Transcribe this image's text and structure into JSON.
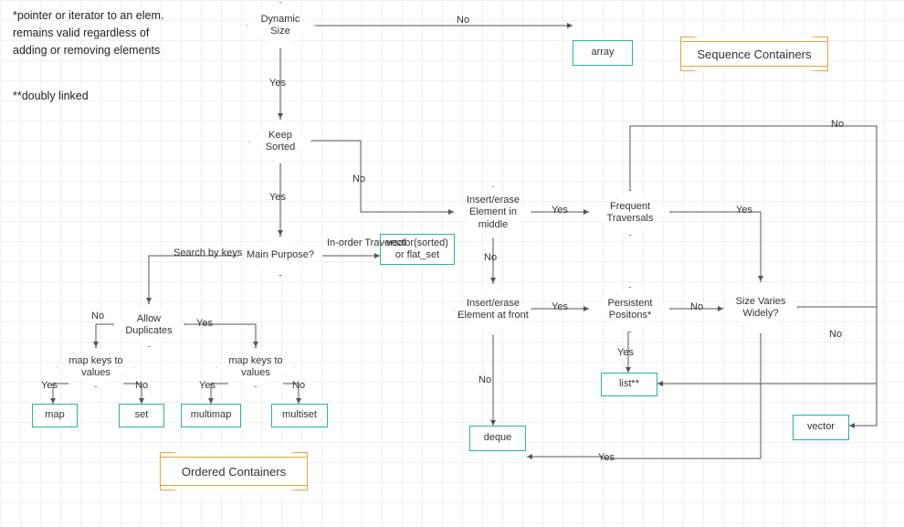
{
  "notes": {
    "note1": "*pointer or iterator to an elem. remains valid regardless of adding or removing elements",
    "note2": "**doubly linked"
  },
  "banners": {
    "sequence": "Sequence Containers",
    "ordered": "Ordered Containers"
  },
  "nodes": {
    "dynamic_size": "Dynamic Size",
    "keep_sorted": "Keep Sorted",
    "main_purpose": "Main Purpose?",
    "allow_duplicates": "Allow Duplicates",
    "map_keys_left": "map keys to values",
    "map_keys_right": "map keys to values",
    "insert_middle": "Insert/erase Element in middle",
    "insert_front": "Insert/erase Element at front",
    "frequent_traversals": "Frequent Traversals",
    "persistent_positions": "Persistent Positons*",
    "size_varies": "Size Varies Widely?",
    "array": "array",
    "vector_sorted": "vector(sorted) or flat_set",
    "map": "map",
    "set": "set",
    "multimap": "multimap",
    "multiset": "multiset",
    "list": "list**",
    "deque": "deque",
    "vector": "vector"
  },
  "edge_labels": {
    "yes": "Yes",
    "no": "No",
    "in_order_traversal": "In-order Traversal",
    "search_by_keys": "Search by keys"
  }
}
